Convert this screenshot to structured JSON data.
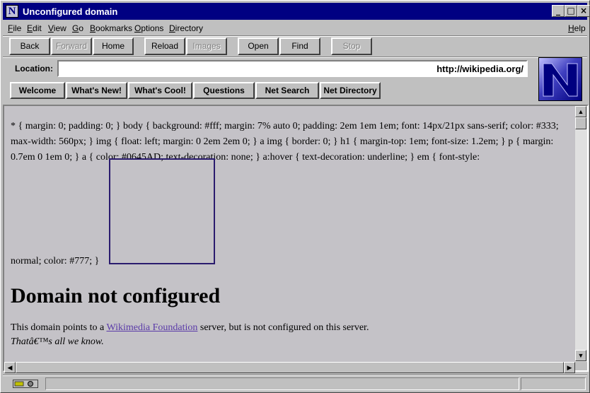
{
  "window": {
    "title": "Unconfigured domain",
    "app_icon_letter": "N"
  },
  "menu": {
    "items": [
      {
        "hot": "F",
        "rest": "ile"
      },
      {
        "hot": "E",
        "rest": "dit"
      },
      {
        "hot": "V",
        "rest": "iew"
      },
      {
        "hot": "G",
        "rest": "o"
      },
      {
        "hot": "B",
        "rest": "ookmarks"
      },
      {
        "hot": "O",
        "rest": "ptions"
      },
      {
        "hot": "D",
        "rest": "irectory"
      },
      {
        "hot": "H",
        "rest": "elp"
      }
    ]
  },
  "toolbar": {
    "back": "Back",
    "forward": "Forward",
    "home": "Home",
    "reload": "Reload",
    "images": "Images",
    "open": "Open",
    "find": "Find",
    "stop": "Stop"
  },
  "location": {
    "label": "Location:",
    "url": "http://wikipedia.org/"
  },
  "directory": {
    "welcome": "Welcome",
    "whats_new": "What's New!",
    "whats_cool": "What's Cool!",
    "questions": "Questions",
    "net_search": "Net Search",
    "net_directory": "Net Directory"
  },
  "page": {
    "css_text": "* { margin: 0; padding: 0; } body { background: #fff; margin: 7% auto 0; padding: 2em 1em 1em; font: 14px/21px sans-serif; color: #333; max-width: 560px; } img { float: left; margin: 0 2em 2em 0; } a img { border: 0; } h1 { margin-top: 1em; font-size: 1.2em; } p { margin: 0.7em 0 1em 0; } a { color: #0645AD; text-decoration: none; } a:hover { text-decoration: underline; } em { font-style:",
    "css_tail": "normal; color: #777; }",
    "heading": "Domain not configured",
    "body_before": "This domain points to a ",
    "body_link": "Wikimedia Foundation",
    "body_after": " server, but is not configured on this server.",
    "body_em": "Thatâ€™s all we know."
  },
  "colors": {
    "titlebar": "#000082",
    "link": "#5a3aa8",
    "content_bg": "#c4c2c7"
  }
}
